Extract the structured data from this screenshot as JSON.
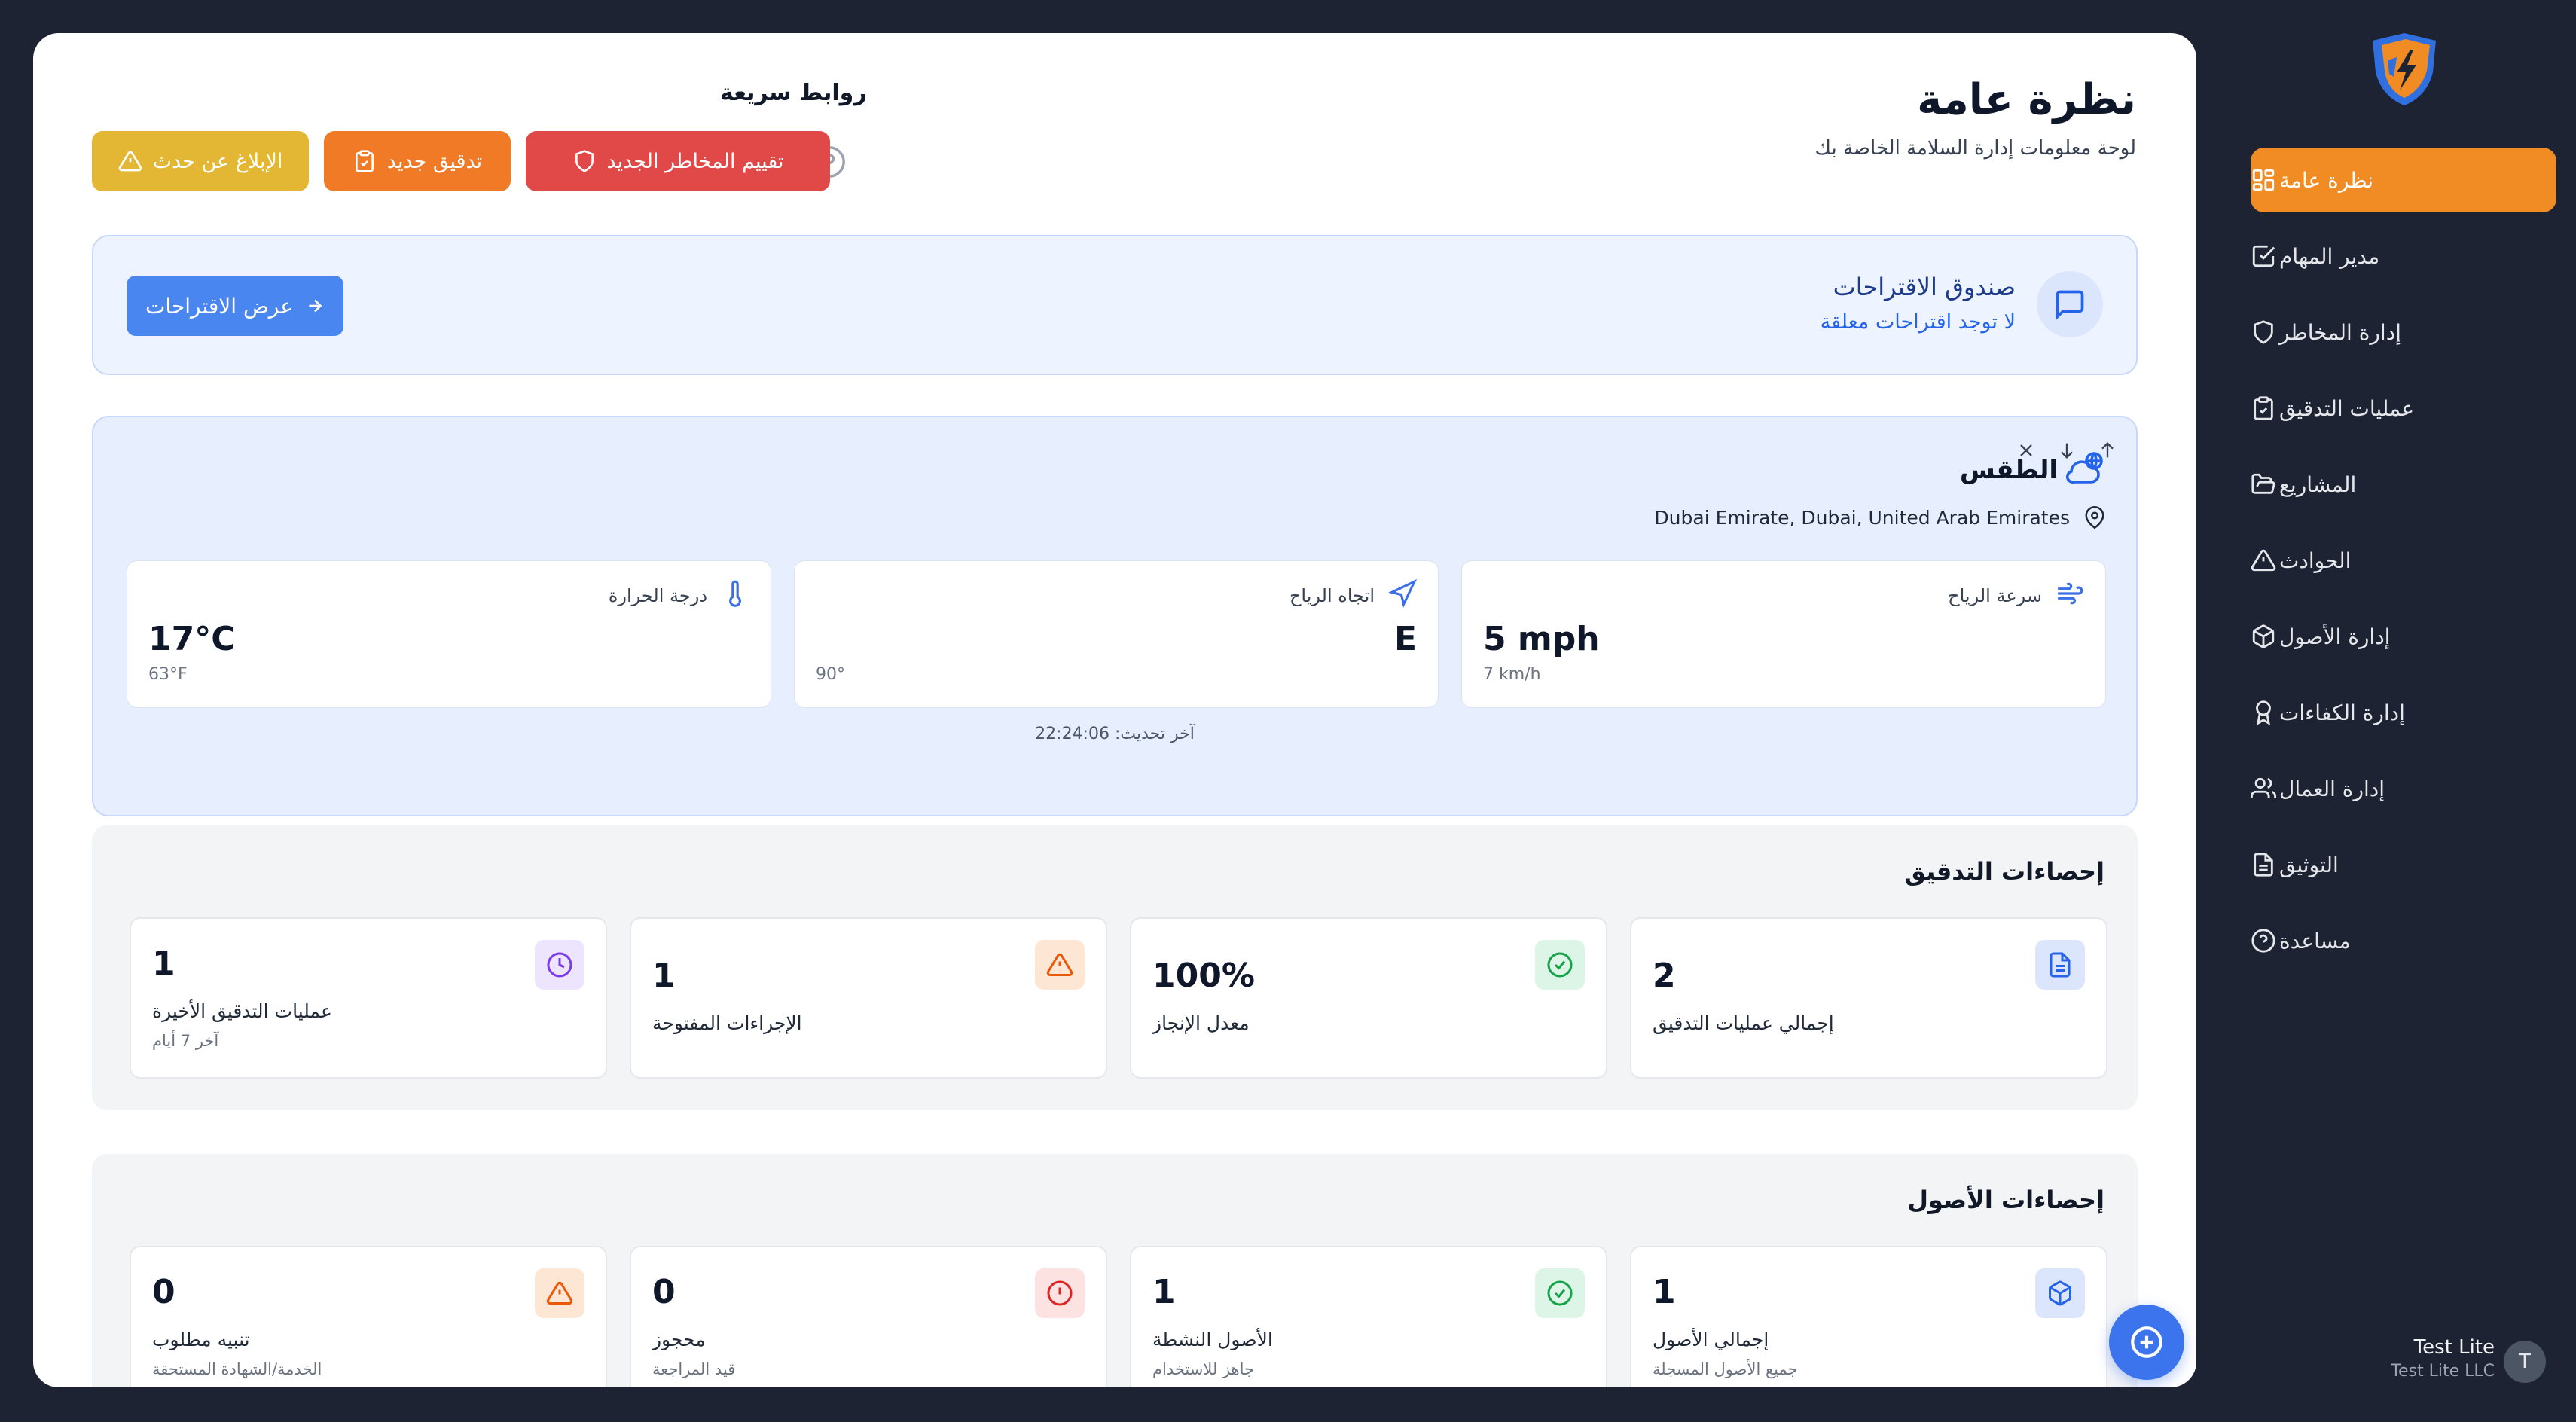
{
  "sidebar": {
    "items": [
      {
        "label": "نظرة عامة",
        "icon": "dashboard-icon",
        "active": true
      },
      {
        "label": "مدير المهام",
        "icon": "task-check-icon"
      },
      {
        "label": "إدارة المخاطر",
        "icon": "shield-icon"
      },
      {
        "label": "عمليات التدقيق",
        "icon": "clipboard-check-icon"
      },
      {
        "label": "المشاريع",
        "icon": "folder-open-icon"
      },
      {
        "label": "الحوادث",
        "icon": "warning-triangle-icon"
      },
      {
        "label": "إدارة الأصول",
        "icon": "package-icon"
      },
      {
        "label": "إدارة الكفاءات",
        "icon": "award-icon"
      },
      {
        "label": "إدارة العمال",
        "icon": "users-icon"
      },
      {
        "label": "التوثيق",
        "icon": "document-icon"
      },
      {
        "label": "مساعدة",
        "icon": "help-circle-icon"
      }
    ],
    "user": {
      "initial": "T",
      "name": "Test Lite",
      "org": "Test Lite LLC"
    }
  },
  "header": {
    "title": "نظرة عامة",
    "subtitle": "لوحة معلومات إدارة السلامة الخاصة بك"
  },
  "quick_links": {
    "title": "روابط سريعة",
    "buttons": {
      "risk": "تقييم المخاطر الجديد",
      "audit": "تدقيق جديد",
      "incident": "الإبلاغ عن حدث"
    }
  },
  "suggestions": {
    "title": "صندوق الاقتراحات",
    "subtitle": "لا توجد اقتراحات معلقة",
    "button": "عرض الاقتراحات"
  },
  "weather": {
    "title": "الطقس",
    "location": "Dubai Emirate, Dubai, United Arab Emirates",
    "wind_speed": {
      "label": "سرعة الرياح",
      "value": "5 mph",
      "sub": "7 km/h"
    },
    "wind_direction": {
      "label": "اتجاه الرياح",
      "value": "E",
      "sub": "90°"
    },
    "temperature": {
      "label": "درجة الحرارة",
      "value": "17°C",
      "sub": "63°F"
    },
    "updated": "آخر تحديث: 22:24:06"
  },
  "audit_stats": {
    "title": "إحصاءات التدقيق",
    "total": {
      "value": "2",
      "label": "إجمالي عمليات التدقيق"
    },
    "completion": {
      "value": "100%",
      "label": "معدل الإنجاز"
    },
    "open_actions": {
      "value": "1",
      "label": "الإجراءات المفتوحة"
    },
    "recent": {
      "value": "1",
      "label": "عمليات التدقيق الأخيرة",
      "sub": "آخر 7 أيام"
    }
  },
  "asset_stats": {
    "title": "إحصاءات الأصول",
    "total": {
      "value": "1",
      "label": "إجمالي الأصول",
      "sub": "جميع الأصول المسجلة"
    },
    "active": {
      "value": "1",
      "label": "الأصول النشطة",
      "sub": "جاهز للاستخدام"
    },
    "reserved": {
      "value": "0",
      "label": "محجوز",
      "sub": "قيد المراجعة"
    },
    "alert": {
      "value": "0",
      "label": "تنبيه مطلوب",
      "sub": "الخدمة/الشهادة المستحقة"
    }
  },
  "colors": {
    "accent": "#f08c23",
    "sidebar_bg": "#1e2334",
    "risk_button": "#e14848",
    "audit_button": "#f07a26",
    "incident_button": "#e3b633",
    "primary_blue": "#4a86f0"
  }
}
